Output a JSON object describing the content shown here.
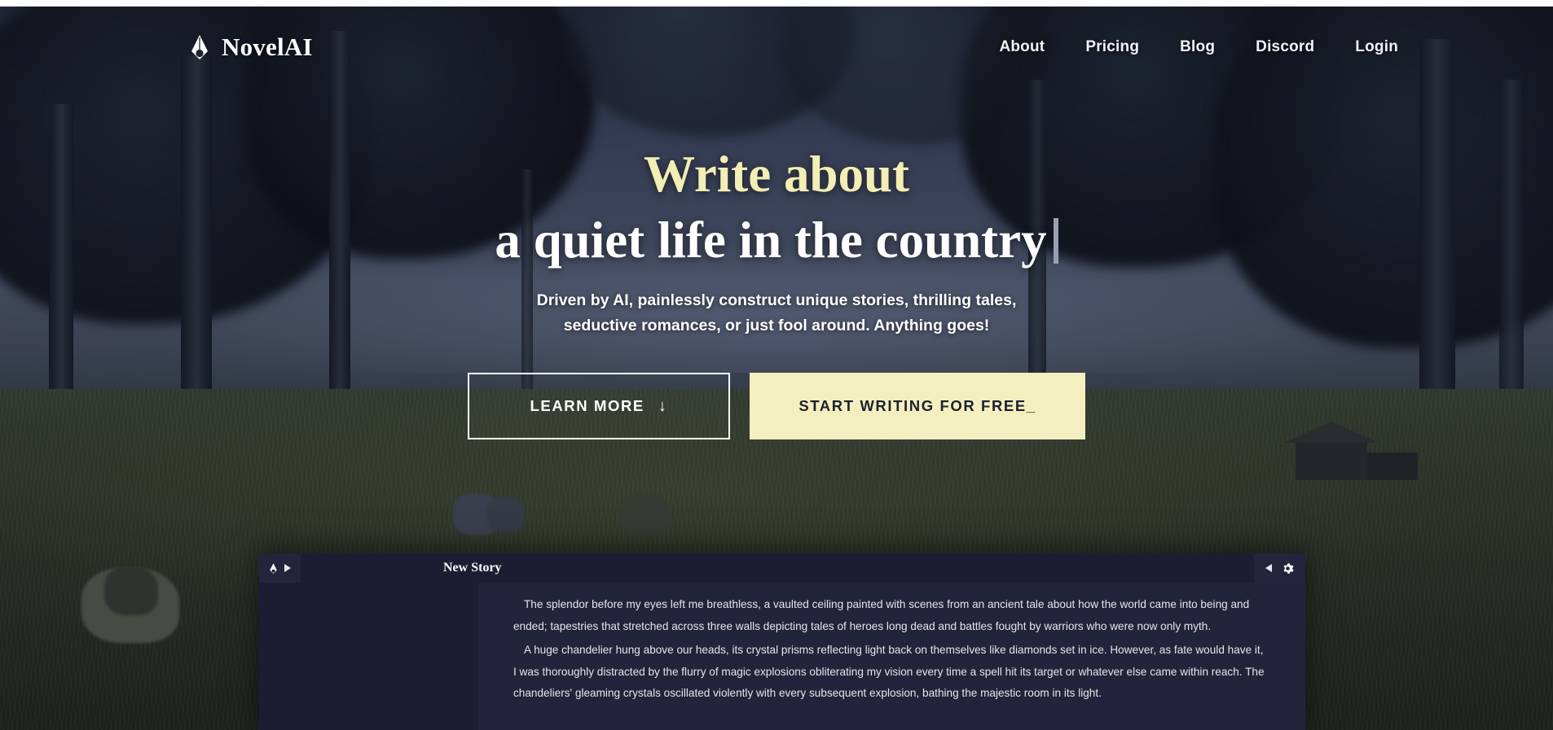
{
  "brand": {
    "name": "NovelAI",
    "logo_icon": "pen-nib-icon"
  },
  "nav": {
    "links": [
      {
        "label": "About"
      },
      {
        "label": "Pricing"
      },
      {
        "label": "Blog"
      },
      {
        "label": "Discord"
      },
      {
        "label": "Login"
      }
    ]
  },
  "hero": {
    "headline_line1": "Write about",
    "headline_line2": "a quiet life in the country",
    "caret": "text-cursor",
    "subtitle_line1": "Driven by AI, painlessly construct unique stories, thrilling tales,",
    "subtitle_line2": "seductive romances, or just fool around. Anything goes!",
    "buttons": {
      "learn_more": {
        "label": "LEARN MORE",
        "icon": "arrow-down-icon",
        "glyph": "↓"
      },
      "start_writing": {
        "label": "START WRITING FOR FREE_"
      }
    }
  },
  "editor": {
    "title": "New Story",
    "left_controls": {
      "logo_icon": "pen-nib-icon",
      "expand_icon": "caret-right-icon"
    },
    "right_controls": {
      "collapse_icon": "caret-left-icon",
      "settings_icon": "gear-icon"
    },
    "paragraphs": [
      "The splendor before my eyes left me breathless, a vaulted ceiling painted with scenes from an ancient tale about how the world came into being and ended; tapestries that stretched across three walls depicting tales of heroes long dead and battles fought by warriors who were now only myth.",
      "A huge chandelier hung above our heads, its crystal prisms reflecting light back on themselves like diamonds set in ice. However, as fate would have it, I was thoroughly distracted by the flurry of magic explosions obliterating my vision every time a spell hit its target or whatever else came within reach. The chandeliers' gleaming crystals oscillated violently with every subsequent explosion, bathing the majestic room in its light."
    ]
  },
  "colors": {
    "accent_cream": "#f4efbe",
    "headline_cream": "#f2eeb4",
    "text_white": "#ffffff",
    "editor_panel": "#1b1d33",
    "editor_text_bg": "#22243b",
    "editor_chrome": "#23253d"
  }
}
